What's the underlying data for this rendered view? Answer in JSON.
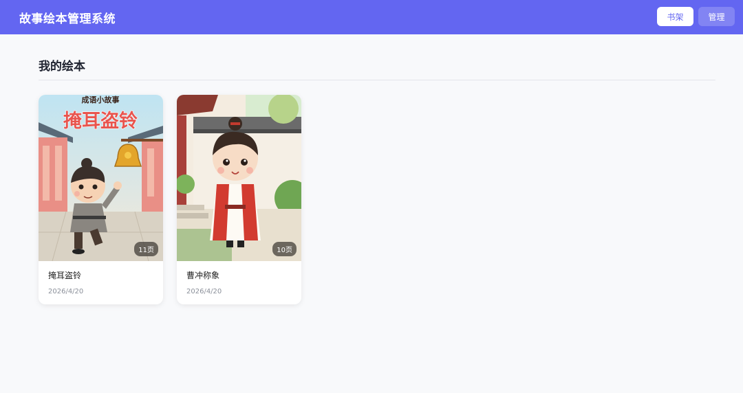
{
  "app": {
    "title": "故事绘本管理系统"
  },
  "nav": {
    "bookshelf_label": "书架",
    "manage_label": "管理"
  },
  "section": {
    "title": "我的绘本"
  },
  "books": [
    {
      "title": "掩耳盗铃",
      "date": "2026/4/20",
      "pages": "11页",
      "cover_series": "成语小故事",
      "cover_title": "掩耳盗铃"
    },
    {
      "title": "曹冲称象",
      "date": "2026/4/20",
      "pages": "10页"
    }
  ],
  "colors": {
    "header": "#6366f1",
    "background": "#f8f9fb",
    "cover_title": "#e8554e"
  }
}
